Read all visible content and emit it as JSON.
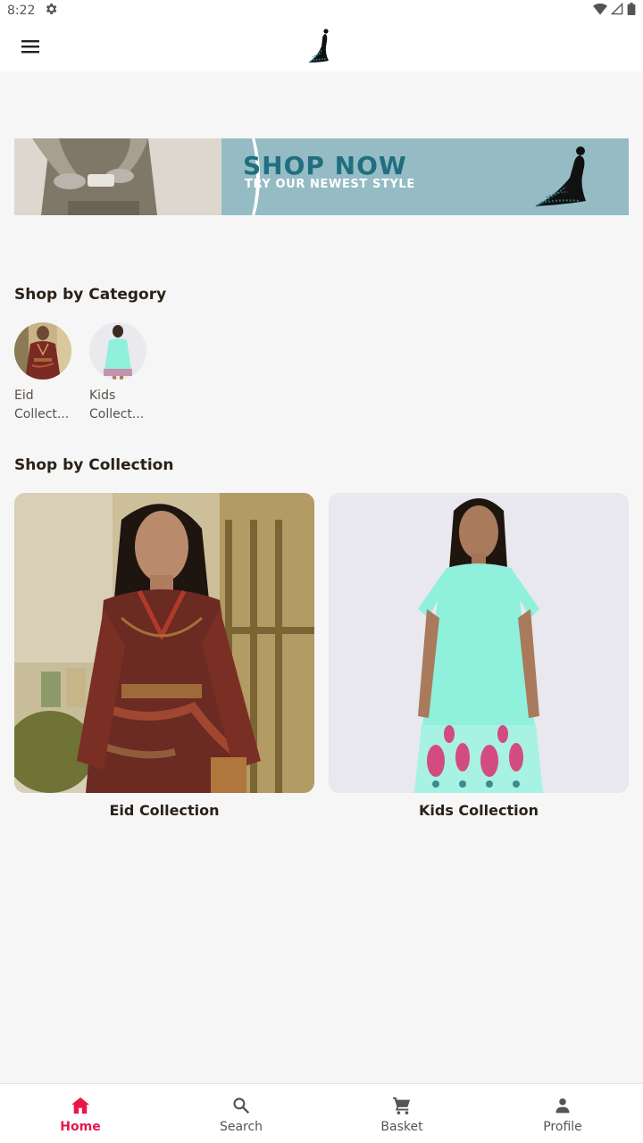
{
  "status_bar": {
    "time": "8:22",
    "icons": [
      "settings-icon",
      "wifi-icon",
      "signal-icon",
      "battery-icon"
    ]
  },
  "app_bar": {
    "menu_icon": "hamburger-menu-icon",
    "logo": "brand-logo-woman-silhouette"
  },
  "banner": {
    "title": "SHOP NOW",
    "subtitle": "TRY OUR NEWEST STYLE",
    "background_color": "#95bcc4",
    "title_color": "#1f6f7f"
  },
  "categories": {
    "heading": "Shop by Category",
    "items": [
      {
        "label": "Eid Collect..."
      },
      {
        "label": "Kids Collect..."
      }
    ]
  },
  "collections": {
    "heading": "Shop by Collection",
    "items": [
      {
        "label": "Eid Collection"
      },
      {
        "label": "Kids Collection"
      }
    ]
  },
  "bottom_nav": {
    "items": [
      {
        "label": "Home",
        "icon": "home-icon",
        "active": true
      },
      {
        "label": "Search",
        "icon": "search-icon",
        "active": false
      },
      {
        "label": "Basket",
        "icon": "cart-icon",
        "active": false
      },
      {
        "label": "Profile",
        "icon": "person-icon",
        "active": false
      }
    ],
    "active_color": "#e8174a"
  }
}
